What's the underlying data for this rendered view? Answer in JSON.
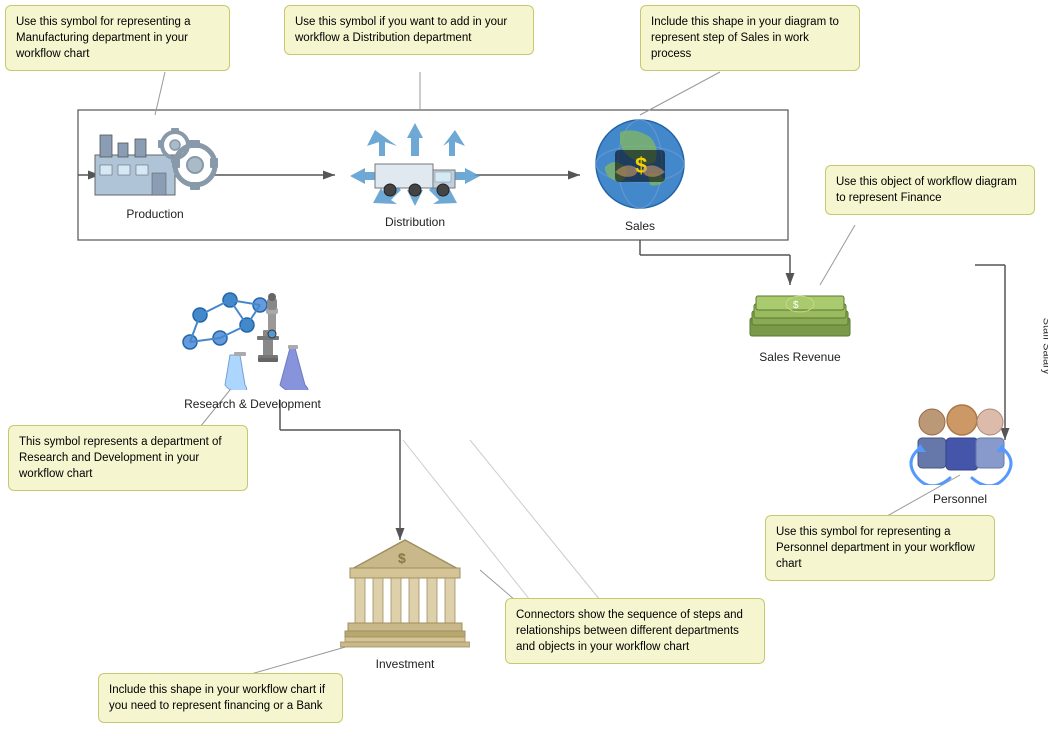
{
  "callouts": {
    "manufacturing": "Use this symbol for representing a Manufacturing department in your workflow chart",
    "distribution": "Use this symbol if you want to add in your workflow a Distribution department",
    "sales": "Include this shape in your diagram to represent step of Sales in work process",
    "finance": "Use this object of workflow diagram to represent Finance",
    "rd": "This symbol represents a department of Research and Development in your workflow chart",
    "personnel": "Use this symbol for representing a Personnel department in your workflow chart",
    "bank": "Include this shape in your workflow chart if you need to represent financing or a Bank",
    "connectors": "Connectors show the sequence of steps and relationships between different departments and objects in your workflow chart"
  },
  "nodes": {
    "production": "Production",
    "distribution": "Distribution",
    "sales": "Sales",
    "salesRevenue": "Sales Revenue",
    "rd": "Research & Development",
    "personnel": "Personnel",
    "investment": "Investment"
  },
  "sideLabels": {
    "staffSalary": "Staff Salary"
  }
}
